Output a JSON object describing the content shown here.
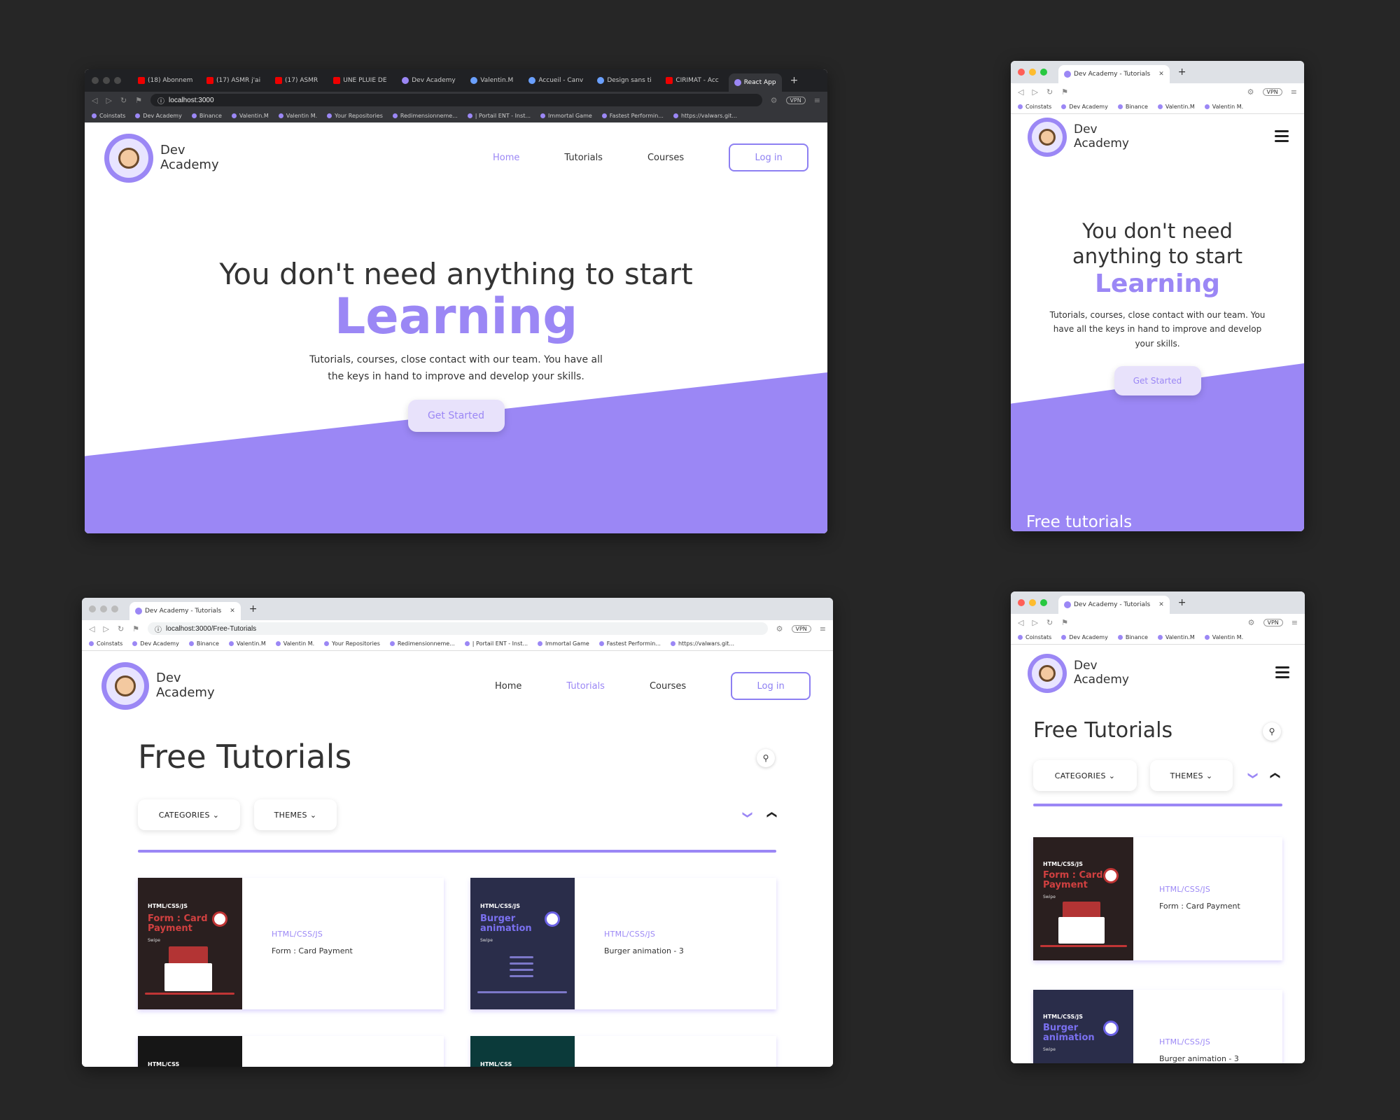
{
  "colors": {
    "accent": "#9b87f5",
    "text": "#333333",
    "background": "#262626"
  },
  "common": {
    "logo_line1": "Dev",
    "logo_line2": "Academy",
    "nav_home": "Home",
    "nav_tutorials": "Tutorials",
    "nav_courses": "Courses",
    "login": "Log in",
    "hero_line1": "You don't need anything to start",
    "hero_learning": "Learning",
    "hero_text": "Tutorials, courses, close contact with our team. You have all the keys in hand to improve and develop your skills.",
    "get_started": "Get Started",
    "free_tutorials_heading": "Free Tutorials",
    "free_tutorials_banner": "Free tutorials",
    "categories": "CATEGORIES",
    "themes": "THEMES",
    "chevron": "❯"
  },
  "bookmarks": [
    "Coinstats",
    "Dev Academy",
    "Binance",
    "Valentin.M",
    "Valentin M.",
    "Your Repositories",
    "Redimensionneme...",
    "| Portail ENT - Inst...",
    "Immortal Game",
    "Fastest Performin...",
    "https://valwars.git..."
  ],
  "short_bookmarks": [
    "Coinstats",
    "Dev Academy",
    "Binance",
    "Valentin.M",
    "Valentin M."
  ],
  "window1": {
    "tabs": [
      "(18) Abonnem",
      "(17) ASMR j'ai",
      "(17) ASMR",
      "UNE PLUIE DE",
      "Dev Academy",
      "Valentin.M",
      "Accueil - Canv",
      "Design sans ti",
      "CIRIMAT - Acc",
      "React App"
    ],
    "url": "localhost:3000"
  },
  "window2": {
    "tab": "Dev Academy - Tutorials"
  },
  "window3": {
    "tab": "Dev Academy - Tutorials",
    "url": "localhost:3000/Free-Tutorials"
  },
  "window4": {
    "tab": "Dev Academy - Tutorials"
  },
  "vpn": "VPN",
  "cards": [
    {
      "category": "HTML/CSS/JS",
      "name": "Form : Card Payment",
      "thumb_tag": "HTML/CSS/JS",
      "thumb_title": "Form : Card Payment",
      "thumb_swipe": "Swipe"
    },
    {
      "category": "HTML/CSS/JS",
      "name": "Burger animation - 3",
      "thumb_tag": "HTML/CSS/JS",
      "thumb_title": "Burger animation",
      "thumb_swipe": "Swipe"
    },
    {
      "thumb_tag": "HTML/CSS"
    },
    {
      "thumb_tag": "HTML/CSS"
    }
  ]
}
